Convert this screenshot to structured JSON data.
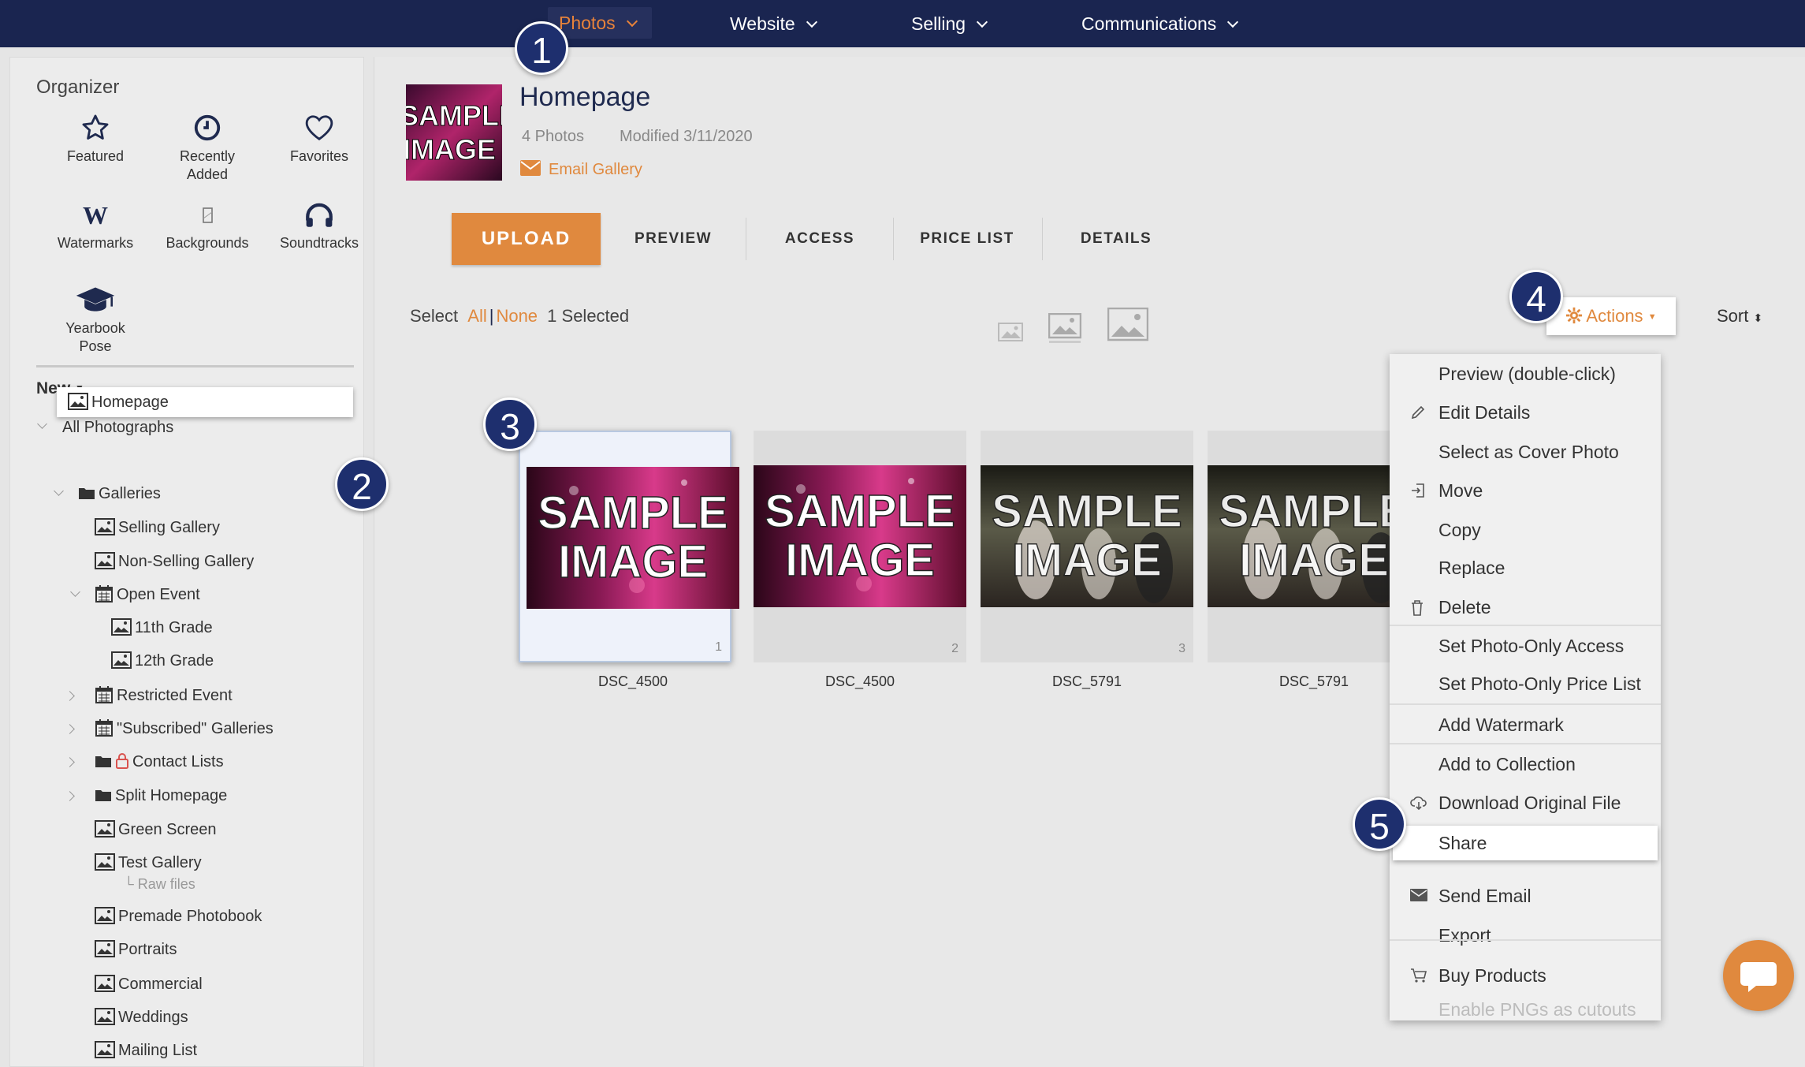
{
  "nav": {
    "items": [
      {
        "label": "Photos",
        "active": true
      },
      {
        "label": "Website"
      },
      {
        "label": "Selling"
      },
      {
        "label": "Communications"
      }
    ]
  },
  "organizer": {
    "title": "Organizer",
    "items": [
      {
        "label_line1": "Featured",
        "label_line2": "",
        "icon": "star-icon"
      },
      {
        "label_line1": "Recently",
        "label_line2": "Added",
        "icon": "clock-icon"
      },
      {
        "label_line1": "Favorites",
        "label_line2": "",
        "icon": "heart-icon"
      },
      {
        "label_line1": "Watermarks",
        "label_line2": "",
        "icon": "watermark-icon"
      },
      {
        "label_line1": "Backgrounds",
        "label_line2": "",
        "icon": "background-icon"
      },
      {
        "label_line1": "Soundtracks",
        "label_line2": "",
        "icon": "headphones-icon"
      },
      {
        "label_line1": "Yearbook",
        "label_line2": "Pose",
        "icon": "graduation-cap-icon"
      }
    ],
    "new_label": "New"
  },
  "tree": [
    {
      "label": "All Photographs",
      "icon": "none",
      "caret": "down"
    },
    {
      "label": "Homepage",
      "icon": "image",
      "caret": "none",
      "selected": true
    },
    {
      "label": "Galleries",
      "icon": "folder",
      "caret": "down"
    },
    {
      "label": "Selling Gallery",
      "icon": "image",
      "caret": "none"
    },
    {
      "label": "Non-Selling Gallery",
      "icon": "image",
      "caret": "none"
    },
    {
      "label": "Open Event",
      "icon": "calendar",
      "caret": "down"
    },
    {
      "label": "11th Grade",
      "icon": "image",
      "caret": "none"
    },
    {
      "label": "12th Grade",
      "icon": "image",
      "caret": "none"
    },
    {
      "label": "Restricted Event",
      "icon": "calendar",
      "caret": "right"
    },
    {
      "label": "\"Subscribed\" Galleries",
      "icon": "calendar",
      "caret": "right"
    },
    {
      "label": "Contact Lists",
      "icon": "folder-lock",
      "caret": "right"
    },
    {
      "label": "Split Homepage",
      "icon": "folder",
      "caret": "right"
    },
    {
      "label": "Green Screen",
      "icon": "image",
      "caret": "none"
    },
    {
      "label": "Test Gallery",
      "icon": "image",
      "caret": "none",
      "sub": "└ Raw files"
    },
    {
      "label": "Premade Photobook",
      "icon": "image",
      "caret": "none"
    },
    {
      "label": "Portraits",
      "icon": "image",
      "caret": "none"
    },
    {
      "label": "Commercial",
      "icon": "image",
      "caret": "none"
    },
    {
      "label": "Weddings",
      "icon": "image",
      "caret": "none"
    },
    {
      "label": "Mailing List",
      "icon": "image",
      "caret": "none"
    }
  ],
  "gallery": {
    "title": "Homepage",
    "photo_count": "4 Photos",
    "modified": "Modified 3/11/2020",
    "email_link": "Email Gallery",
    "thumb_text_1": "SAMPLE",
    "thumb_text_2": "IMAGE"
  },
  "tabs": {
    "upload": "UPLOAD",
    "items": [
      "PREVIEW",
      "ACCESS",
      "PRICE LIST",
      "DETAILS"
    ]
  },
  "selection": {
    "select_label": "Select",
    "all_label": "All",
    "sep": "|",
    "none_label": "None",
    "selected_text": "1 Selected"
  },
  "toolbar": {
    "actions_label": "Actions",
    "sort_label": "Sort"
  },
  "photos": [
    {
      "name": "DSC_4500",
      "index": "1",
      "selected": true,
      "style": "stage",
      "text1": "SAMPLE",
      "text2": "IMAGE"
    },
    {
      "name": "DSC_4500",
      "index": "2",
      "selected": false,
      "style": "stage",
      "text1": "SAMPLE",
      "text2": "IMAGE"
    },
    {
      "name": "DSC_5791",
      "index": "3",
      "selected": false,
      "style": "outdoor",
      "text1": "SAMPLE",
      "text2": "IMAGE"
    },
    {
      "name": "DSC_5791",
      "index": "",
      "selected": false,
      "style": "outdoor",
      "text1": "SAMPLE",
      "text2": "IMAGE"
    }
  ],
  "actions_menu": [
    {
      "label": "Preview (double-click)",
      "icon": ""
    },
    {
      "label": "Edit Details",
      "icon": "pencil-icon"
    },
    {
      "label": "Select as Cover Photo",
      "icon": ""
    },
    {
      "label": "Move",
      "icon": "move-icon"
    },
    {
      "label": "Copy",
      "icon": ""
    },
    {
      "label": "Replace",
      "icon": ""
    },
    {
      "label": "Delete",
      "icon": "trash-icon"
    },
    {
      "label": "Set Photo-Only Access",
      "icon": ""
    },
    {
      "label": "Set Photo-Only Price List",
      "icon": ""
    },
    {
      "label": "Add Watermark",
      "icon": ""
    },
    {
      "label": "Add to Collection",
      "icon": ""
    },
    {
      "label": "Download Original File",
      "icon": "cloud-download-icon"
    },
    {
      "label": "Share",
      "icon": "",
      "highlighted": true
    },
    {
      "label": "Send Email",
      "icon": "envelope-icon"
    },
    {
      "label": "Export",
      "icon": ""
    },
    {
      "label": "Buy Products",
      "icon": "cart-icon"
    },
    {
      "label": "Enable PNGs as cutouts",
      "icon": "",
      "disabled": true
    }
  ],
  "badges": [
    "1",
    "2",
    "3",
    "4",
    "5"
  ],
  "colors": {
    "nav_bg": "#1a2550",
    "accent": "#e0893e",
    "badge": "#1e2f6e"
  }
}
